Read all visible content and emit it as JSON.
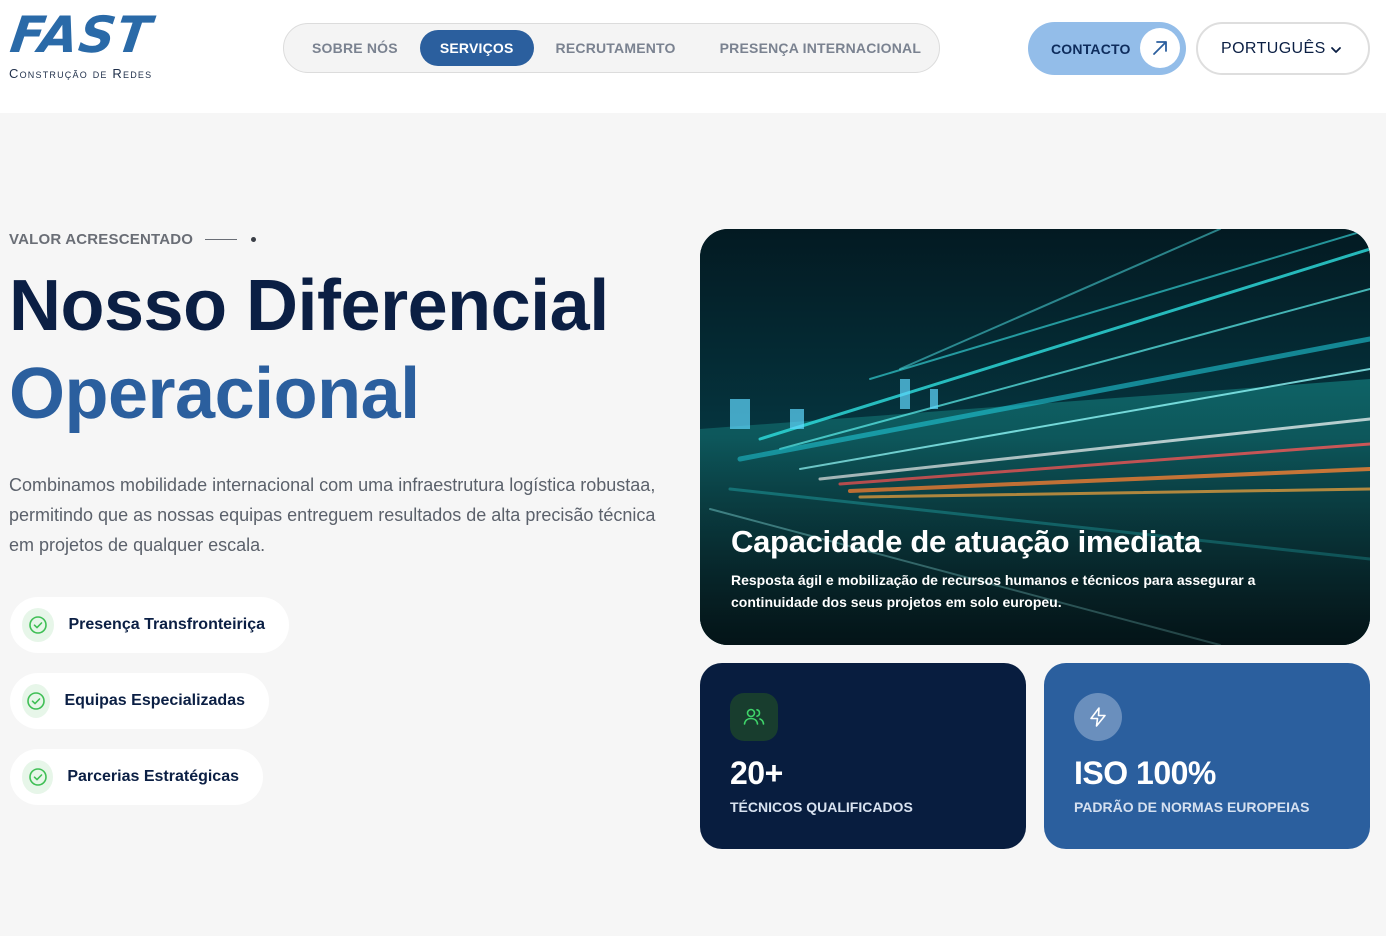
{
  "brand": {
    "logo_word": "FAST",
    "logo_sub": "Construção de Redes"
  },
  "nav": {
    "items": [
      {
        "label": "SOBRE NÓS"
      },
      {
        "label": "SERVIÇOS"
      },
      {
        "label": "RECRUTAMENTO"
      },
      {
        "label": "PRESENÇA INTERNACIONAL"
      }
    ],
    "active_index": 1
  },
  "header": {
    "contact_label": "CONTACTO",
    "language_label": "PORTUGUÊS"
  },
  "section": {
    "eyebrow": "VALOR ACRESCENTADO",
    "title_line1": "Nosso Diferencial",
    "title_line2": "Operacional",
    "description": "Combinamos mobilidade internacional com uma infraestrutura logística robustaa, permitindo que as nossas equipas entreguem resultados de alta precisão técnica em projetos de qualquer escala.",
    "features": [
      {
        "label": "Presença Transfronteiriça"
      },
      {
        "label": "Equipas Especializadas"
      },
      {
        "label": "Parcerias Estratégicas"
      }
    ]
  },
  "hero_card": {
    "title": "Capacidade de atuação imediata",
    "text": "Resposta ágil e mobilização de recursos humanos e técnicos para assegurar a continuidade dos seus projetos em solo europeu."
  },
  "stats": [
    {
      "value": "20+",
      "label": "TÉCNICOS QUALIFICADOS",
      "icon": "users-icon"
    },
    {
      "value": "ISO 100%",
      "label": "PADRÃO DE NORMAS EUROPEIAS",
      "icon": "lightning-icon"
    }
  ],
  "colors": {
    "primary": "#2b5f9e",
    "navy": "#0b1f44",
    "contact_bg": "#93bde9",
    "success": "#3fbf55"
  }
}
